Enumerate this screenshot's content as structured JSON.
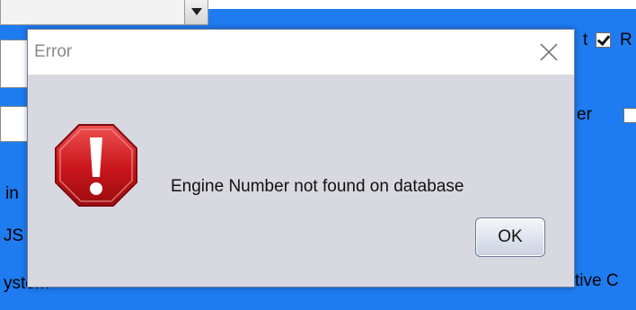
{
  "background": {
    "fragments": {
      "frag_t": "t",
      "frag_r": "R",
      "frag_er": "er",
      "frag_in": "in",
      "frag_js": "JS",
      "frag_system": "ystem",
      "frag_tive": "tive C"
    }
  },
  "dialog": {
    "title": "Error",
    "message": "Engine Number not found on database",
    "ok_label": "OK",
    "icon": "error-stop-icon",
    "close_icon": "close-icon"
  },
  "colors": {
    "background_app": "#1e7bf0",
    "dialog_body": "#d8d9e0",
    "error_red": "#c8151b"
  }
}
